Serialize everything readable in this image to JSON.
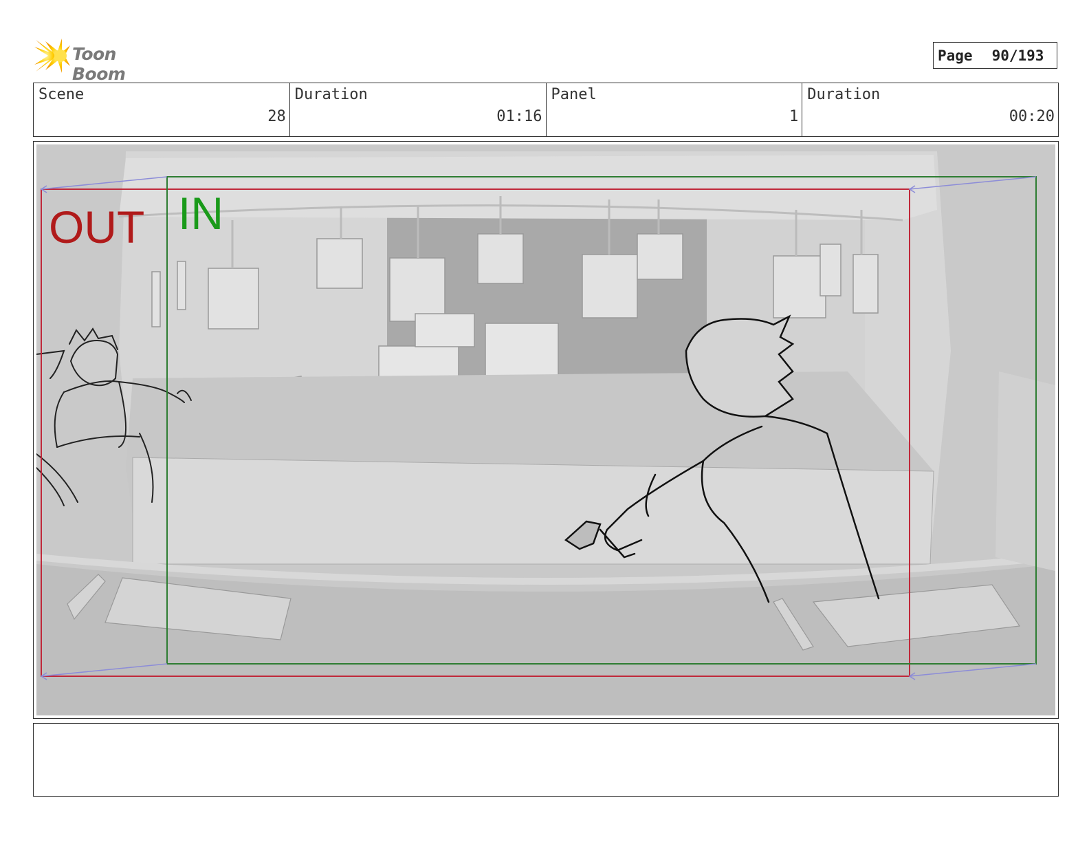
{
  "header": {
    "logo_text": "Toon Boom",
    "page_label": "Page",
    "page_value": "90/193"
  },
  "info": {
    "scene_label": "Scene",
    "scene_value": "28",
    "scene_duration_label": "Duration",
    "scene_duration_value": "01:16",
    "panel_label": "Panel",
    "panel_value": "1",
    "panel_duration_label": "Duration",
    "panel_duration_value": "00:20"
  },
  "panel": {
    "out_label": "OUT",
    "in_label": "IN",
    "out_color": "#b01a1a",
    "in_color": "#1a9a1a",
    "frame_out_color": "#c0283a",
    "frame_in_color": "#2e7d32"
  },
  "notes": {
    "text": ""
  }
}
